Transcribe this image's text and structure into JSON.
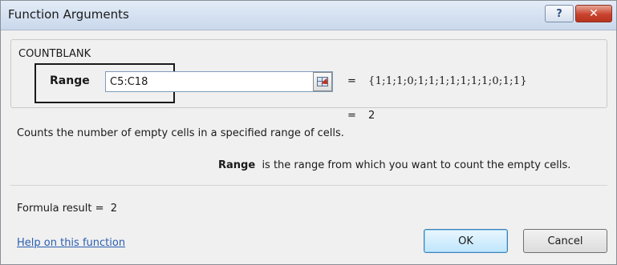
{
  "window": {
    "title": "Function Arguments",
    "help_glyph": "?",
    "close_glyph": "✕"
  },
  "function": {
    "name": "COUNTBLANK",
    "argument": {
      "label": "Range",
      "value": "C5:C18",
      "equals": "=",
      "evaluated": "{1;1;1;0;1;1;1;1;1;1;1;0;1;1}"
    },
    "result_equals": "=",
    "result_value": "2",
    "description": "Counts the number of empty cells in a specified range of cells.",
    "argument_help": {
      "name": "Range",
      "text": "is the range from which you want to count the empty cells."
    }
  },
  "footer": {
    "formula_result_label": "Formula result =",
    "formula_result_value": "2",
    "help_link": "Help on this function",
    "ok_label": "OK",
    "cancel_label": "Cancel"
  },
  "icons": {
    "help": "help-icon",
    "close": "close-icon",
    "collapse": "collapse-dialog-icon"
  },
  "colors": {
    "close_button": "#c9432e",
    "link": "#2a5db0",
    "ok_border": "#3c7fb1"
  }
}
